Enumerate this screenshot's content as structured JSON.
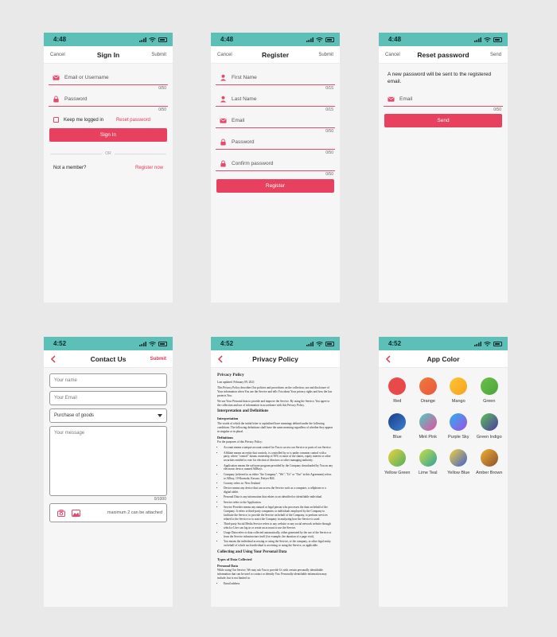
{
  "signin": {
    "time": "4:48",
    "nav": {
      "left": "Cancel",
      "title": "Sign In",
      "right": "Submit"
    },
    "email_label": "Email or Username",
    "email_counter": "0/50",
    "password_label": "Password",
    "password_counter": "0/50",
    "keep_logged": "Keep me logged in",
    "reset_link": "Reset password",
    "button": "Sign In",
    "or": "OR",
    "not_member": "Not a member?",
    "register_link": "Register now"
  },
  "register": {
    "time": "4:48",
    "nav": {
      "left": "Cancel",
      "title": "Register",
      "right": "Submit"
    },
    "first_name": "First Name",
    "first_counter": "0/15",
    "last_name": "Last Name",
    "last_counter": "0/15",
    "email": "Email",
    "email_counter": "0/50",
    "password": "Password",
    "password_counter": "0/50",
    "confirm": "Confirm password",
    "confirm_counter": "0/50",
    "button": "Register"
  },
  "reset": {
    "time": "4:48",
    "nav": {
      "left": "Cancel",
      "title": "Reset password",
      "right": "Send"
    },
    "message": "A new password will be sent to the registered email.",
    "email": "Email",
    "email_counter": "0/50",
    "button": "Send"
  },
  "contact": {
    "time": "4:52",
    "nav": {
      "title": "Contact Us",
      "right": "Submit"
    },
    "name_placeholder": "Your name",
    "email_placeholder": "Your Email",
    "subject": "Purchase of goods",
    "message_placeholder": "Your message",
    "message_counter": "0/1000",
    "attach_note": "maximum 2 can be attached"
  },
  "privacy": {
    "time": "4:52",
    "nav": {
      "title": "Privacy Policy"
    },
    "heading": "Privacy Policy",
    "updated": "Last updated: February 09, 2021",
    "p1": "This Privacy Policy describes Our policies and procedures on the collection, use and disclosure of Your information when You use the Service and tells You about Your privacy rights and how the law protects You.",
    "p2": "We use Your Personal data to provide and improve the Service. By using the Service, You agree to the collection and use of information in accordance with this Privacy Policy.",
    "h_interp": "Interpretation and Definitions",
    "h_interpretation": "Interpretation",
    "p3": "The words of which the initial letter is capitalized have meanings defined under the following conditions. The following definitions shall have the same meaning regardless of whether they appear in singular or in plural.",
    "h_definitions": "Definitions",
    "p4": "For the purposes of this Privacy Policy:",
    "defs": [
      "Account means a unique account created for You to access our Service or parts of our Service.",
      "Affiliate means an entity that controls, is controlled by or is under common control with a party, where \"control\" means ownership of 50% or more of the shares, equity interest or other securities entitled to vote for election of directors or other managing authority.",
      "Application means the software program provided by the Company downloaded by You on any electronic device, named AllBoys",
      "Company (referred to as either \"the Company\", \"We\", \"Us\" or \"Our\" in this Agreement) refers to Allboy, 10-Kormala, Kavasa, Fotiyer Hill.",
      "Country refers to: New Zealand",
      "Device means any device that can access the Service such as a computer, a cellphone or a digital tablet.",
      "Personal Data is any information that relates to an identified or identifiable individual.",
      "Service refers to the Application.",
      "Service Provider means any natural or legal person who processes the data on behalf of the Company. It refers to third-party companies or individuals employed by the Company to facilitate the Service, to provide the Service on behalf of the Company, to perform services related to the Service or to assist the Company in analyzing how the Service is used.",
      "Third-party Social Media Service refers to any website or any social network website through which a User can log in or create an account to use the Service.",
      "Usage Data refers to data collected automatically, either generated by the use of the Service or from the Service infrastructure itself (for example, the duration of a page visit).",
      "You means the individual accessing or using the Service, or the company, or other legal entity on behalf of which such individual is accessing or using the Service, as applicable."
    ],
    "h_collecting": "Collecting and Using Your Personal Data",
    "h_types": "Types of Data Collected",
    "h_personal": "Personal Data",
    "p5": "While using Our Service, We may ask You to provide Us with certain personally identifiable information that can be used to contact or identify You. Personally identifiable information may include, but is not limited to:",
    "last_item": "Email address"
  },
  "appcolor": {
    "time": "4:52",
    "nav": {
      "title": "App Color"
    },
    "colors": [
      {
        "name": "Red",
        "a": "#e84a4a",
        "b": "#e84a4a"
      },
      {
        "name": "Orange",
        "a": "#f07a3c",
        "b": "#e8573a"
      },
      {
        "name": "Mango",
        "a": "#ffc53a",
        "b": "#f6a21b"
      },
      {
        "name": "Green",
        "a": "#6cc04a",
        "b": "#4aa43a"
      },
      {
        "name": "Blue",
        "a": "#1a3f8a",
        "b": "#3a7fd0"
      },
      {
        "name": "Mint Pink",
        "a": "#4ad0c0",
        "b": "#e84aa0"
      },
      {
        "name": "Purple Sky",
        "a": "#2ab0f0",
        "b": "#a050e0"
      },
      {
        "name": "Green Indigo",
        "a": "#5ec05a",
        "b": "#4a3aa0"
      },
      {
        "name": "Yellow Green",
        "a": "#f0d040",
        "b": "#4ab060"
      },
      {
        "name": "Lime Teal",
        "a": "#c8e040",
        "b": "#30a0a0"
      },
      {
        "name": "Yellow Blue",
        "a": "#f0d040",
        "b": "#4060d0"
      },
      {
        "name": "Amber Brown",
        "a": "#f0b030",
        "b": "#8a5030"
      }
    ]
  }
}
